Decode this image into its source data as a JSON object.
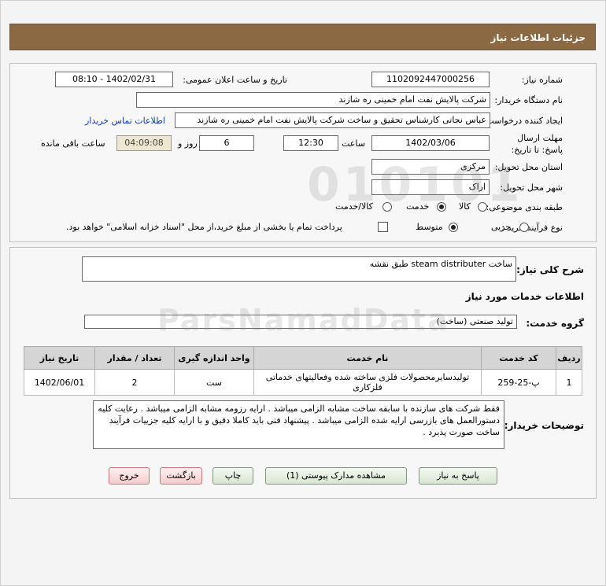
{
  "header": {
    "title": "جزئیات اطلاعات نیاز"
  },
  "fields": {
    "need_number_label": "شماره نیاز:",
    "need_number": "1102092447000256",
    "announce_label": "تاریخ و ساعت اعلان عمومی:",
    "announce_value": "1402/02/31 - 08:10",
    "buyer_org_label": "نام دستگاه خریدار:",
    "buyer_org": "شرکت پالایش نفت امام خمینی  ره  شازند",
    "creator_label": "ایجاد کننده درخواست:",
    "creator": "عباس نجاتی کارشناس تحقیق و ساخت شرکت پالایش نفت امام خمینی  ره  شازند",
    "contact_link": "اطلاعات تماس خریدار",
    "deadline_label": "مهلت ارسال پاسخ: تا تاریخ:",
    "deadline_date": "1402/03/06",
    "time_label": "ساعت",
    "deadline_time": "12:30",
    "days_value": "6",
    "days_label": "روز و",
    "remaining_time": "04:09:08",
    "remaining_label": "ساعت باقی مانده",
    "province_label": "استان محل تحویل:",
    "province": "مرکزی",
    "city_label": "شهر محل تحویل:",
    "city": "اراک",
    "category_label": "طبقه بندی موضوعی:",
    "category_options": [
      "کالا",
      "خدمت",
      "کالا/خدمت"
    ],
    "purchase_type_label": "نوع فرآیند خرید :",
    "purchase_options": [
      "جزیی",
      "متوسط"
    ],
    "payment_note": "پرداخت تمام یا بخشی از مبلغ خرید،از محل \"اسناد خزانه اسلامی\" خواهد بود."
  },
  "summary": {
    "label": "شرح کلی نیاز:",
    "value": "ساخت steam distributer طبق نقشه",
    "services_heading": "اطلاعات خدمات مورد نیاز",
    "service_group_label": "گروه خدمت:",
    "service_group": "تولید صنعتی (ساخت)"
  },
  "table": {
    "headers": [
      "ردیف",
      "کد خدمت",
      "نام خدمت",
      "واحد اندازه گیری",
      "تعداد / مقدار",
      "تاریخ نیاز"
    ],
    "rows": [
      [
        "1",
        "پ-25-259",
        "تولیدسایرمحصولات فلزی ساخته شده وفعالیتهای خدماتی فلزکاری",
        "ست",
        "2",
        "1402/06/01"
      ]
    ]
  },
  "notes": {
    "label": "توضیحات خریدار:",
    "text": "فقط شرکت های سازنده با سابقه ساخت مشابه الزامی میباشد . ارایه رزومه مشابه الزامی میباشد . رعایت کلیه دستورالعمل های بازرسی ارایه شده الزامی میباشد . پیشنهاد فنی باید کاملا دقیق و با ارایه کلیه جزییات فرآیند ساخت صورت پذیرد ."
  },
  "buttons": {
    "reply": "پاسخ به نیاز",
    "attachments": "مشاهده مدارک پیوستی (1)",
    "print": "چاپ",
    "back": "بازگشت",
    "exit": "خروج"
  },
  "watermark": {
    "line1": "010101",
    "line2": "ParsNamadData"
  }
}
